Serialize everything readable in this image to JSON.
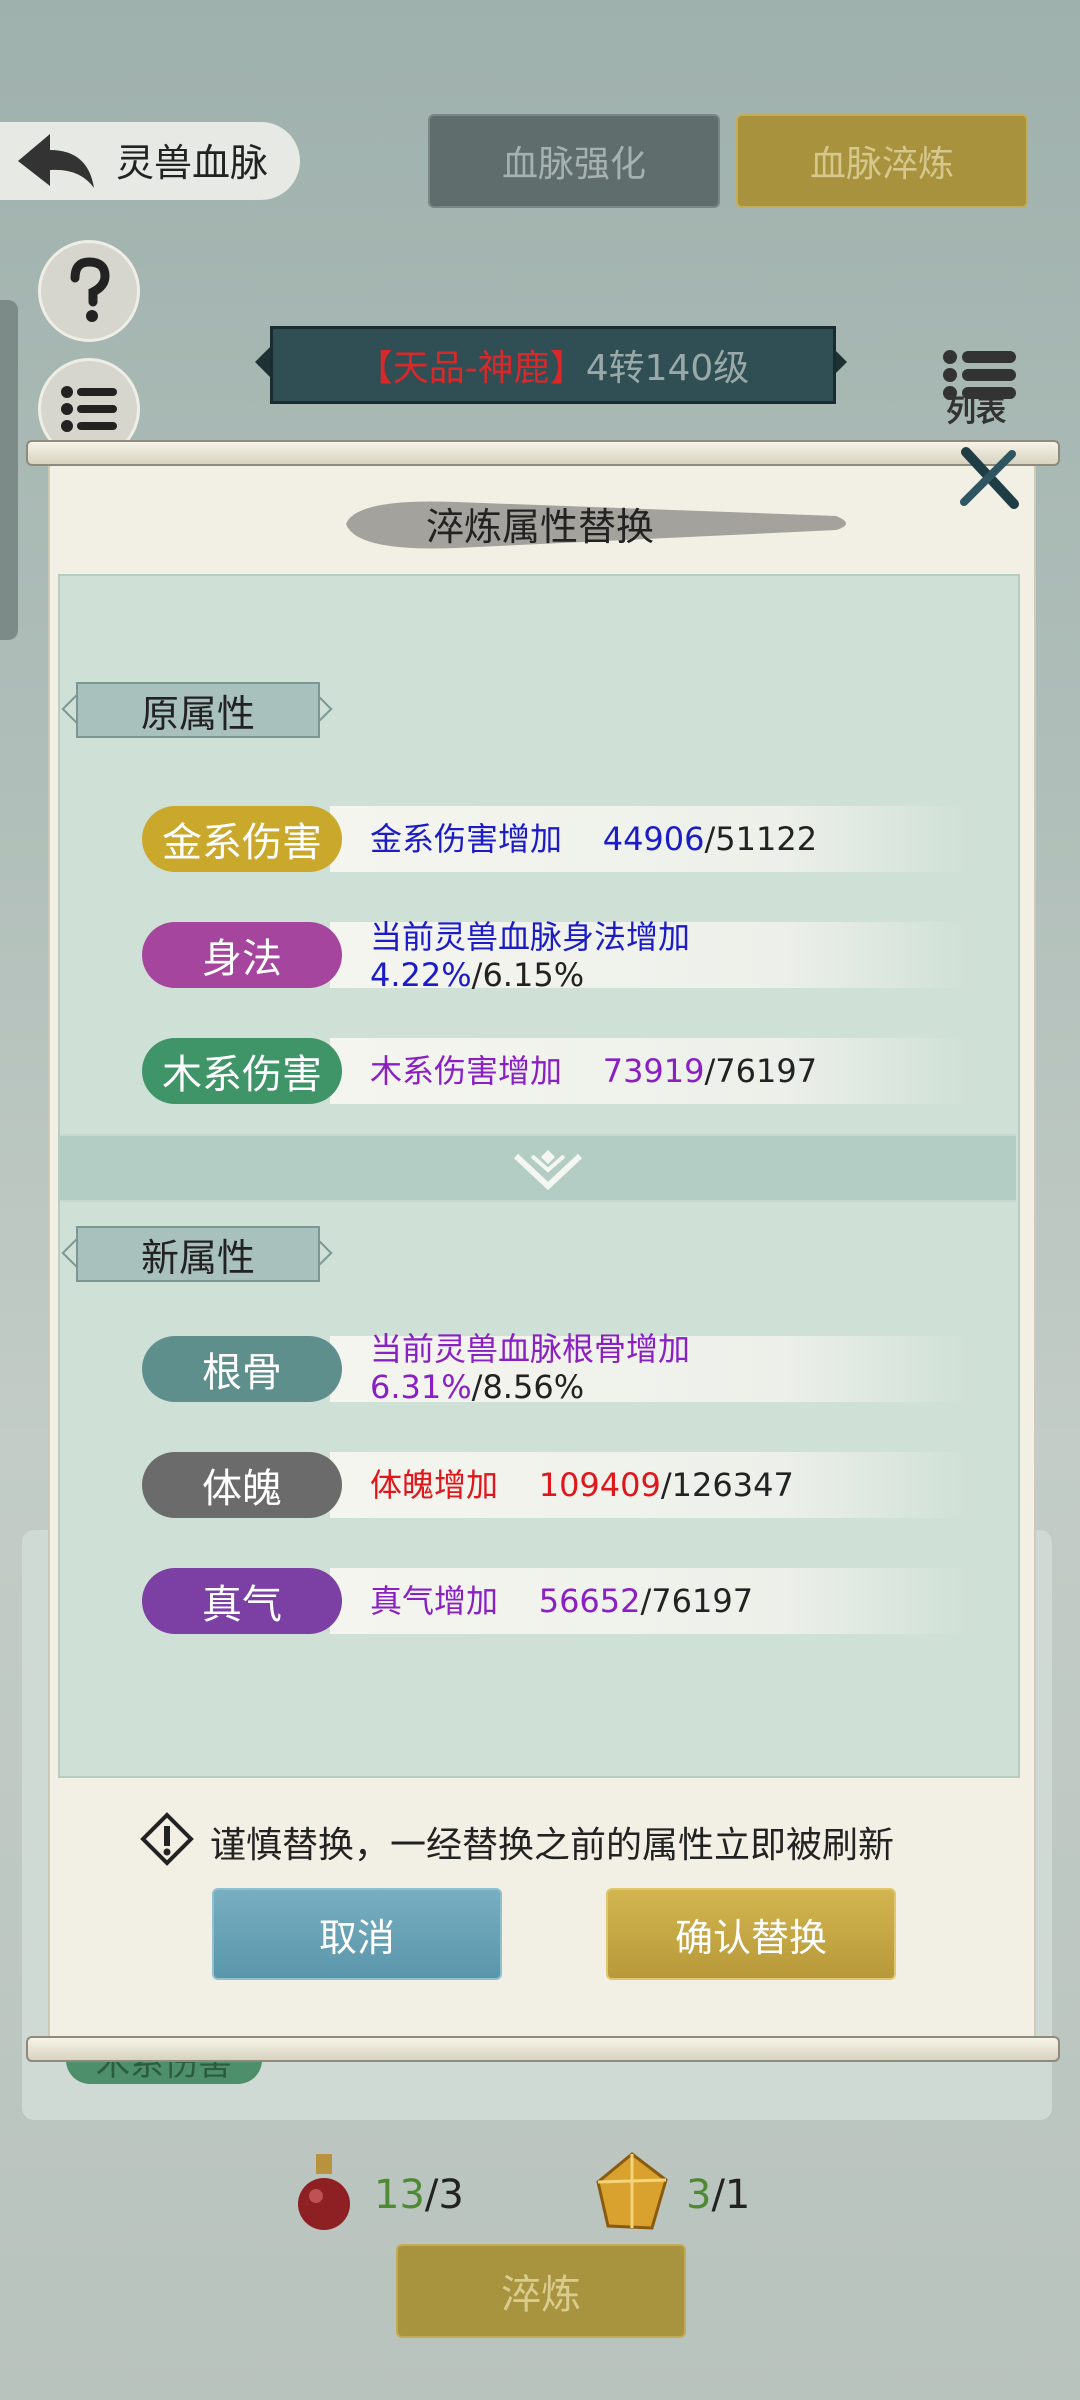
{
  "header": {
    "title": "灵兽血脉",
    "tabs": [
      {
        "label": "血脉强化"
      },
      {
        "label": "血脉淬炼"
      }
    ]
  },
  "banner": {
    "name": "【天品-神鹿】",
    "level": "4转140级"
  },
  "list_label": "列表",
  "dialog": {
    "title": "淬炼属性替换",
    "original_section": "原属性",
    "new_section": "新属性",
    "original_attrs": [
      {
        "tag": "金系伤害",
        "desc": "金系伤害增加",
        "value": "44906",
        "max": "/51122",
        "color": "#1b1bc8",
        "pill": "#c9a82c"
      },
      {
        "tag": "身法",
        "desc": "当前灵兽血脉身法增加",
        "value": "4.22%",
        "max": "/6.15%",
        "color": "#1b1bc8",
        "pill": "#a5459e"
      },
      {
        "tag": "木系伤害",
        "desc": "木系伤害增加",
        "value": "73919",
        "max": "/76197",
        "color": "#8a1fc4",
        "pill": "#3f9468"
      }
    ],
    "new_attrs": [
      {
        "tag": "根骨",
        "desc": "当前灵兽血脉根骨增加",
        "value": "6.31%",
        "max": "/8.56%",
        "color": "#8a1fc4",
        "pill": "#5f8f8d"
      },
      {
        "tag": "体魄",
        "desc": "体魄增加",
        "value": "109409",
        "max": "/126347",
        "color": "#e0161b",
        "pill": "#6b6b6b"
      },
      {
        "tag": "真气",
        "desc": "真气增加",
        "value": "56652",
        "max": "/76197",
        "color": "#8a1fc4",
        "pill": "#7c3fa4"
      }
    ],
    "warning": "谨慎替换，一经替换之前的属性立即被刷新",
    "cancel_label": "取消",
    "confirm_label": "确认替换"
  },
  "underlying": {
    "tag": "木系伤害"
  },
  "resources": {
    "potion_have": "13",
    "potion_need": "/3",
    "crystal_have": "3",
    "crystal_need": "/1"
  },
  "refine_label": "淬炼"
}
